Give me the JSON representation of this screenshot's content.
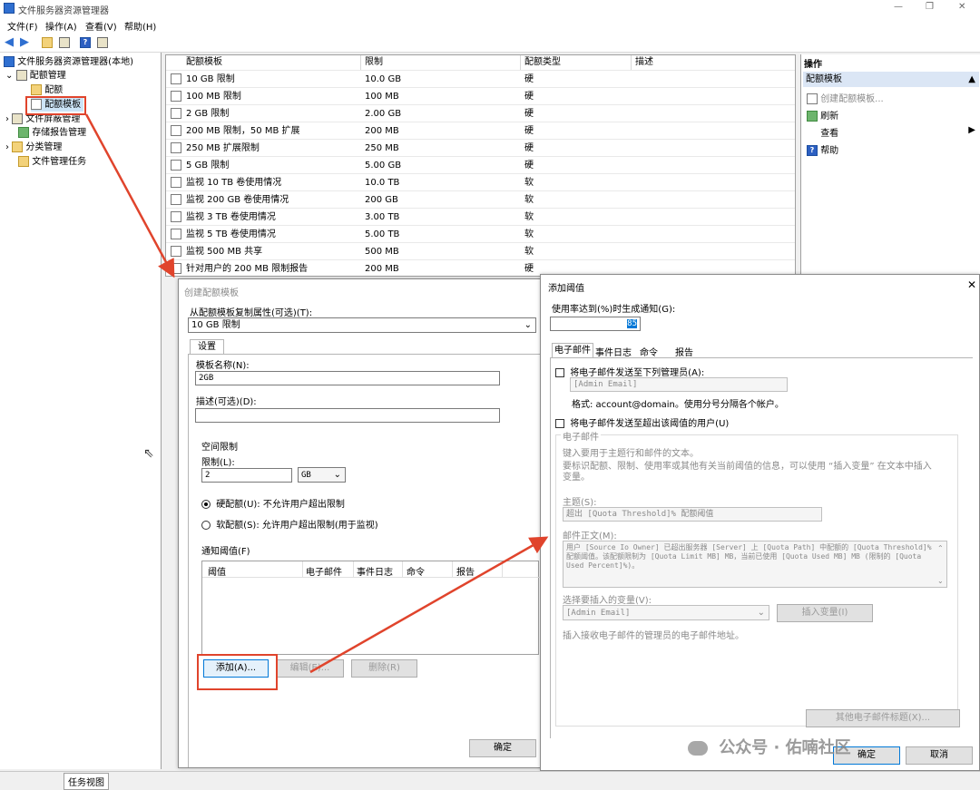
{
  "window": {
    "title": "文件服务器资源管理器",
    "controls": [
      "—",
      "❐",
      "✕"
    ]
  },
  "menu": [
    "文件(F)",
    "操作(A)",
    "查看(V)",
    "帮助(H)"
  ],
  "tree": {
    "root": "文件服务器资源管理器(本地)",
    "items": [
      "配额管理",
      "配额",
      "配额模板",
      "文件屏蔽管理",
      "存储报告管理",
      "分类管理",
      "文件管理任务"
    ]
  },
  "list": {
    "columns": [
      "配额模板",
      "限制",
      "配额类型",
      "描述"
    ],
    "rows": [
      {
        "name": "10 GB 限制",
        "limit": "10.0 GB",
        "type": "硬"
      },
      {
        "name": "100 MB 限制",
        "limit": "100 MB",
        "type": "硬"
      },
      {
        "name": "2 GB 限制",
        "limit": "2.00 GB",
        "type": "硬"
      },
      {
        "name": "200 MB 限制，50 MB 扩展",
        "limit": "200 MB",
        "type": "硬"
      },
      {
        "name": "250 MB 扩展限制",
        "limit": "250 MB",
        "type": "硬"
      },
      {
        "name": "5 GB 限制",
        "limit": "5.00 GB",
        "type": "硬"
      },
      {
        "name": "监视 10 TB 卷使用情况",
        "limit": "10.0 TB",
        "type": "软"
      },
      {
        "name": "监视 200 GB 卷使用情况",
        "limit": "200 GB",
        "type": "软"
      },
      {
        "name": "监视 3 TB 卷使用情况",
        "limit": "3.00 TB",
        "type": "软"
      },
      {
        "name": "监视 5 TB 卷使用情况",
        "limit": "5.00 TB",
        "type": "软"
      },
      {
        "name": "监视 500 MB 共享",
        "limit": "500 MB",
        "type": "软"
      },
      {
        "name": "针对用户的 200 MB 限制报告",
        "limit": "200 MB",
        "type": "硬"
      }
    ]
  },
  "actions": {
    "title": "操作",
    "section": "配额模板",
    "items": [
      "创建配额模板...",
      "刷新",
      "查看",
      "帮助"
    ]
  },
  "create_dlg": {
    "title": "创建配额模板",
    "copy_label": "从配额模板复制属性(可选)(T):",
    "copy_value": "10 GB 限制",
    "tab": "设置",
    "name_label": "模板名称(N):",
    "name_value": "2GB",
    "desc_label": "描述(可选)(D):",
    "space_group": "空间限制",
    "limit_label": "限制(L):",
    "limit_value": "2",
    "unit_value": "GB",
    "hard_label": "硬配额(U): 不允许用户超出限制",
    "soft_label": "软配额(S): 允许用户超出限制(用于监视)",
    "thresh_group": "通知阈值(F)",
    "thresh_columns": [
      "阈值",
      "电子邮件",
      "事件日志",
      "命令",
      "报告"
    ],
    "add_btn": "添加(A)...",
    "edit_btn": "编辑(E)...",
    "delete_btn": "删除(R)",
    "ok_btn": "确定"
  },
  "threshold_dlg": {
    "title": "添加阈值",
    "usage_label": "使用率达到(%)时生成通知(G):",
    "usage_value": "85",
    "tabs": [
      "电子邮件",
      "事件日志",
      "命令",
      "报告"
    ],
    "send_admin_label": "将电子邮件发送至下列管理员(A):",
    "admin_email_placeholder": "[Admin Email]",
    "format_note": "格式: account@domain。使用分号分隔各个帐户。",
    "send_user_label": "将电子邮件发送至超出该阈值的用户(U)",
    "email_group": "电子邮件",
    "email_hint1": "键入要用于主题行和邮件的文本。",
    "email_hint2": "要标识配额、限制、使用率或其他有关当前阈值的信息，可以使用 “插入变量” 在文本中插入变量。",
    "subject_label": "主题(S):",
    "subject_value": "超出 [Quota Threshold]% 配额阈值",
    "body_label": "邮件正文(M):",
    "body_value": "用户 [Source Io Owner] 已超出服务器 [Server] 上 [Quota Path] 中配额的 [Quota Threshold]% 配额阈值。该配额限制为 [Quota Limit MB] MB，当前已使用 [Quota Used MB] MB (限制的 [Quota Used Percent]%)。",
    "var_label": "选择要插入的变量(V):",
    "var_value": "[Admin Email]",
    "insert_btn": "插入变量(I)",
    "var_hint": "插入接收电子邮件的管理员的电子邮件地址。",
    "other_headers_btn": "其他电子邮件标题(X)...",
    "ok_btn": "确定",
    "cancel_btn": "取消"
  },
  "status": {
    "tab": "任务视图"
  },
  "watermark": "公众号 · 佑喃社区",
  "colors": {
    "highlight_red": "#e0442c",
    "selection_blue": "#cce4f7",
    "action_header": "#dbe6f5"
  }
}
